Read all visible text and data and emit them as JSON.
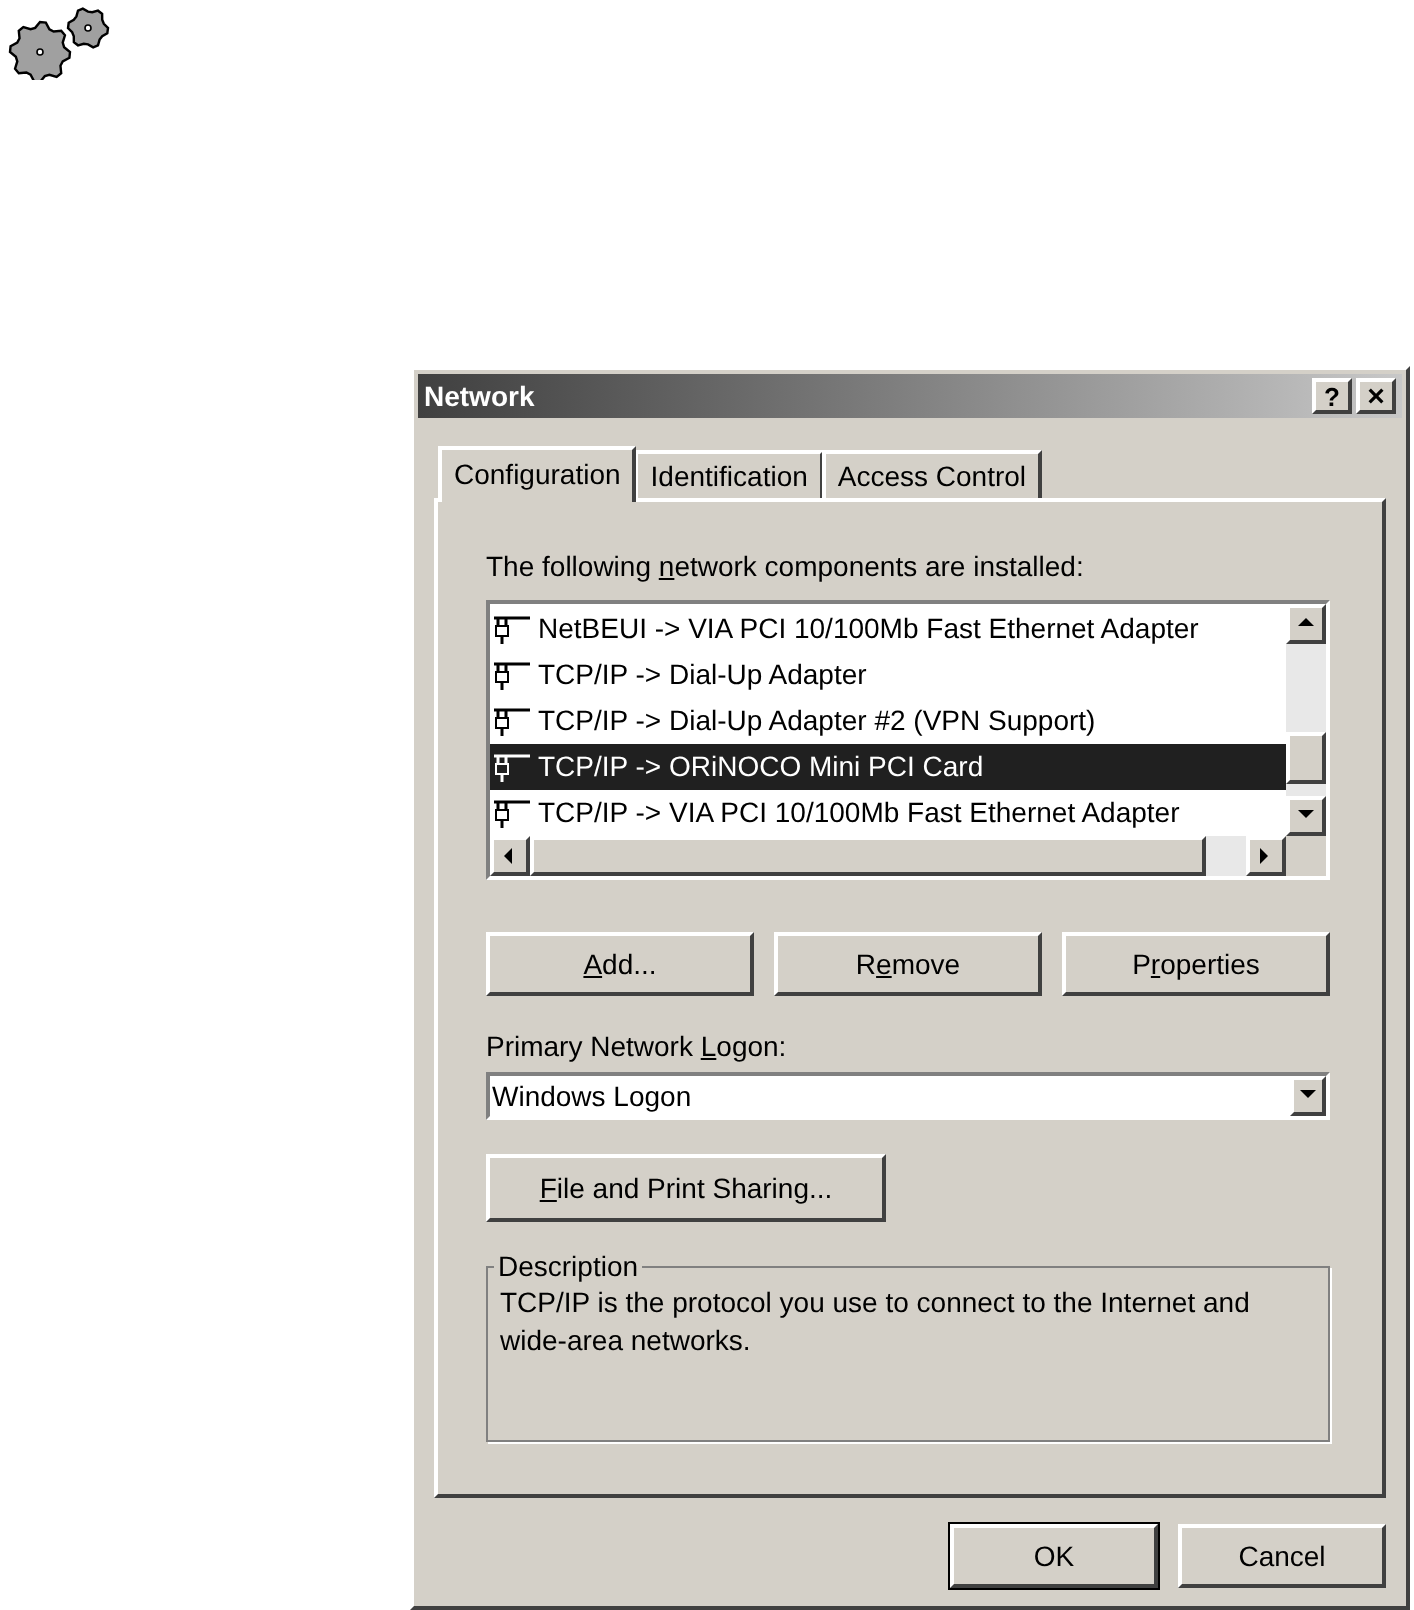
{
  "window": {
    "title": "Network",
    "help_button": "?",
    "close_button": "×"
  },
  "tabs": [
    {
      "label": "Configuration",
      "selected": true
    },
    {
      "label": "Identification",
      "selected": false
    },
    {
      "label": "Access Control",
      "selected": false
    }
  ],
  "components_label": {
    "before": "The following ",
    "key": "n",
    "after": "etwork components are installed:"
  },
  "components": [
    {
      "label": "NetBEUI -> VIA PCI 10/100Mb Fast Ethernet Adapter",
      "selected": false
    },
    {
      "label": "TCP/IP -> Dial-Up Adapter",
      "selected": false
    },
    {
      "label": "TCP/IP -> Dial-Up Adapter #2 (VPN Support)",
      "selected": false
    },
    {
      "label": "TCP/IP -> ORiNOCO Mini PCI Card",
      "selected": true
    },
    {
      "label": "TCP/IP -> VIA PCI 10/100Mb Fast Ethernet Adapter",
      "selected": false
    }
  ],
  "component_buttons": [
    {
      "key": "A",
      "after": "dd..."
    },
    {
      "before": "R",
      "key": "e",
      "after": "move"
    },
    {
      "before": "P",
      "key": "r",
      "after": "operties"
    }
  ],
  "logon": {
    "label": {
      "before": "Primary Network ",
      "key": "L",
      "after": "ogon:"
    },
    "value": "Windows Logon"
  },
  "sharing_button": {
    "key": "F",
    "after": "ile and Print Sharing..."
  },
  "description": {
    "title": "Description",
    "text": "TCP/IP is the protocol you use to connect to the Internet and wide-area networks."
  },
  "footer_buttons": [
    {
      "label": "OK",
      "default": true
    },
    {
      "label": "Cancel",
      "default": false
    }
  ]
}
